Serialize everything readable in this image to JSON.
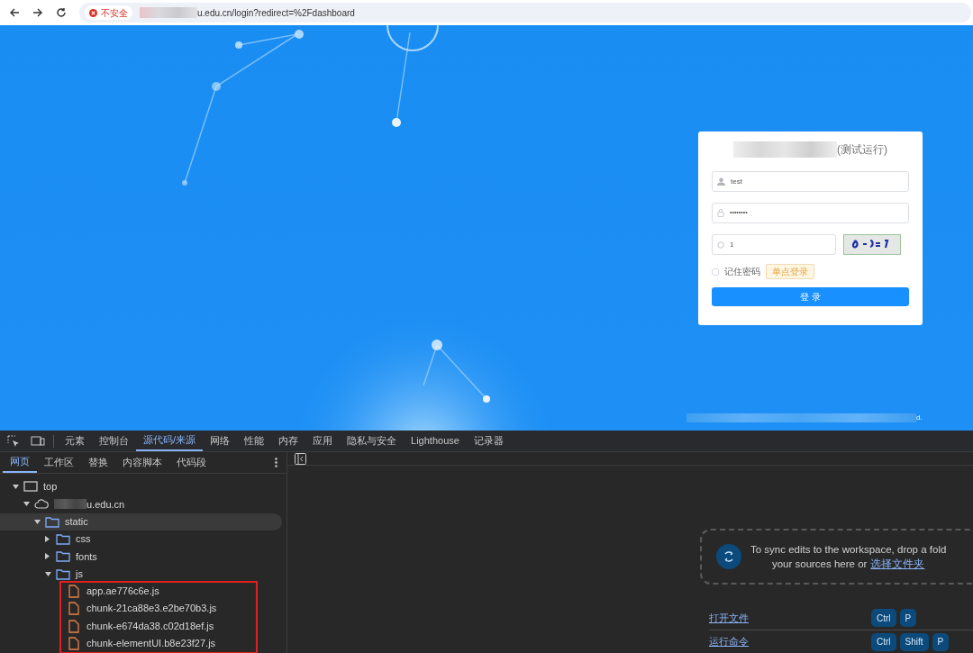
{
  "browser": {
    "security_label": "不安全",
    "url": "u.edu.cn/login?redirect=%2Fdashboard"
  },
  "login": {
    "title": "(测试运行)",
    "username": {
      "value": "test"
    },
    "password": {
      "value": "••••••••"
    },
    "captcha": {
      "value": "1"
    },
    "remember": {
      "label": "记住密码",
      "checked": false
    },
    "sso_button": "单点登录",
    "submit_button": "登 录"
  },
  "footer_text": "d.",
  "devtools": {
    "tabs": [
      {
        "label": "元素",
        "selected": false
      },
      {
        "label": "控制台",
        "selected": false
      },
      {
        "label": "源代码/来源",
        "selected": true
      },
      {
        "label": "网络",
        "selected": false
      },
      {
        "label": "性能",
        "selected": false
      },
      {
        "label": "内存",
        "selected": false
      },
      {
        "label": "应用",
        "selected": false
      },
      {
        "label": "隐私与安全",
        "selected": false
      },
      {
        "label": "Lighthouse",
        "selected": false
      },
      {
        "label": "记录器",
        "selected": false
      }
    ],
    "sub_tabs": [
      {
        "label": "网页",
        "selected": true
      },
      {
        "label": "工作区",
        "selected": false
      },
      {
        "label": "替换",
        "selected": false
      },
      {
        "label": "内容脚本",
        "selected": false
      },
      {
        "label": "代码段",
        "selected": false
      }
    ],
    "tree": [
      {
        "label": "top",
        "kind": "frame",
        "expanded": true,
        "selected": false,
        "children": [
          {
            "label": "u.edu.cn",
            "kind": "domain",
            "expanded": true,
            "selected": false,
            "children": [
              {
                "label": "static",
                "kind": "folder",
                "expanded": true,
                "selected": true,
                "children": [
                  {
                    "label": "css",
                    "kind": "folder",
                    "expanded": false,
                    "selected": false
                  },
                  {
                    "label": "fonts",
                    "kind": "folder",
                    "expanded": false,
                    "selected": false
                  },
                  {
                    "label": "js",
                    "kind": "folder",
                    "expanded": true,
                    "selected": false,
                    "children": [
                      {
                        "label": "app.ae776c6e.js",
                        "kind": "file",
                        "selected": false
                      },
                      {
                        "label": "chunk-21ca88e3.e2be70b3.js",
                        "kind": "file",
                        "selected": false
                      },
                      {
                        "label": "chunk-e674da38.c02d18ef.js",
                        "kind": "file",
                        "selected": false
                      },
                      {
                        "label": "chunk-elementUI.b8e23f27.js",
                        "kind": "file",
                        "selected": false
                      }
                    ]
                  }
                ]
              }
            ]
          }
        ]
      }
    ],
    "workspace": {
      "line_1": "To sync edits to the workspace, drop a fold",
      "line_2": "your sources here or",
      "link": "选择文件夹"
    },
    "shortcuts": [
      {
        "label": "打开文件",
        "keys": [
          "Ctrl",
          "P"
        ]
      },
      {
        "label": "运行命令",
        "keys": [
          "Ctrl",
          "Shift",
          "P"
        ]
      }
    ]
  }
}
